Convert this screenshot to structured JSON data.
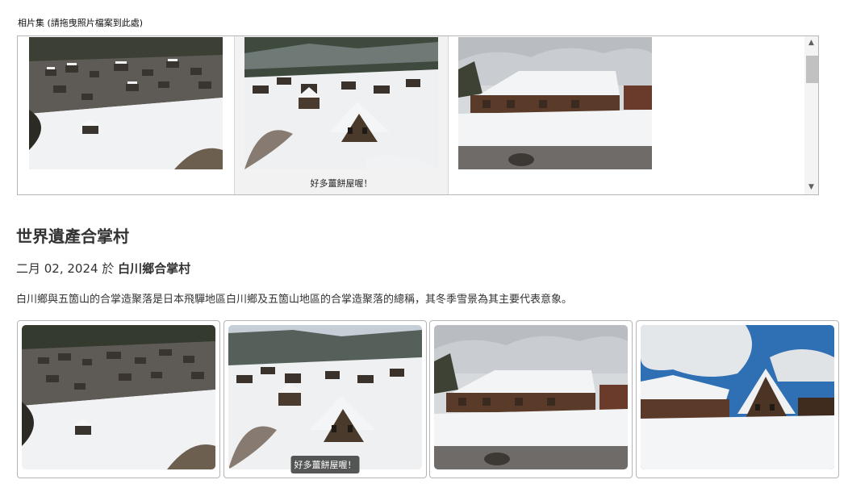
{
  "album": {
    "label": "相片集 (請拖曳照片檔案到此處)",
    "items": [
      {
        "icon": "village-overview-photo",
        "caption": ""
      },
      {
        "icon": "thatched-houses-photo",
        "caption": "好多薑餅屋喔！"
      },
      {
        "icon": "farmhouse-photo",
        "caption": ""
      }
    ]
  },
  "post": {
    "title": "世界遺產合掌村",
    "date": "二月 02, 2024",
    "location_sep": "於",
    "location": "白川鄉合掌村",
    "description": "白川鄉與五箇山的合掌造聚落是日本飛驒地區白川鄉及五箇山地區的合掌造聚落的總稱，其冬季雪景為其主要代表意象。"
  },
  "gallery": [
    {
      "icon": "village-overview-photo",
      "caption": ""
    },
    {
      "icon": "thatched-houses-photo",
      "caption": "好多薑餅屋喔！"
    },
    {
      "icon": "farmhouse-photo",
      "caption": ""
    },
    {
      "icon": "gassho-houses-blue-sky-photo",
      "caption": ""
    }
  ]
}
